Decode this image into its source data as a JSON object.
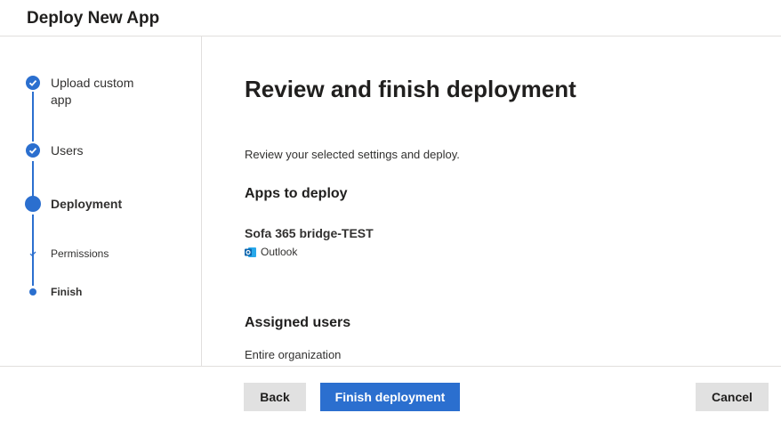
{
  "header": {
    "title": "Deploy New App"
  },
  "steps": {
    "upload": "Upload custom app",
    "users": "Users",
    "deployment": "Deployment",
    "permissions": "Permissions",
    "finish": "Finish"
  },
  "main": {
    "heading": "Review and finish deployment",
    "description": "Review your selected settings and deploy.",
    "apps_heading": "Apps to deploy",
    "app_name": "Sofa 365 bridge-TEST",
    "app_client": "Outlook",
    "app_client_icon": "outlook-icon",
    "users_heading": "Assigned users",
    "users_value": "Entire organization"
  },
  "footer": {
    "back_label": "Back",
    "finish_label": "Finish deployment",
    "cancel_label": "Cancel"
  },
  "colors": {
    "accent": "#2b6fcf",
    "secondary_button": "#e1e1e1",
    "divider": "#e1dfdd"
  }
}
